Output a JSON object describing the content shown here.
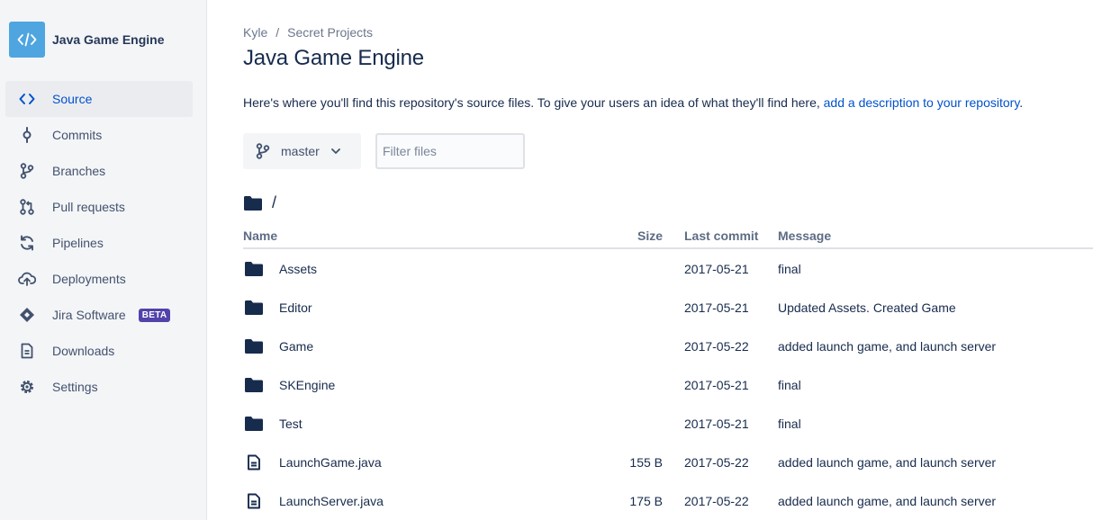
{
  "repo": {
    "name": "Java Game Engine"
  },
  "sidebar": {
    "items": [
      {
        "label": "Source",
        "icon": "code-icon",
        "active": true
      },
      {
        "label": "Commits",
        "icon": "commit-icon"
      },
      {
        "label": "Branches",
        "icon": "branch-icon"
      },
      {
        "label": "Pull requests",
        "icon": "pull-request-icon"
      },
      {
        "label": "Pipelines",
        "icon": "pipelines-icon"
      },
      {
        "label": "Deployments",
        "icon": "deployments-icon"
      },
      {
        "label": "Jira Software",
        "icon": "jira-icon",
        "badge": "BETA"
      },
      {
        "label": "Downloads",
        "icon": "downloads-icon"
      },
      {
        "label": "Settings",
        "icon": "gear-icon"
      }
    ]
  },
  "breadcrumb": {
    "owner": "Kyle",
    "separator": "/",
    "project": "Secret Projects"
  },
  "page": {
    "title": "Java Game Engine",
    "description_text": "Here's where you'll find this repository's source files. To give your users an idea of what they'll find here, ",
    "description_link": "add a description to your repository",
    "description_end": "."
  },
  "branch": {
    "name": "master"
  },
  "filter": {
    "placeholder": "Filter files",
    "value": ""
  },
  "path": {
    "current": "/"
  },
  "table": {
    "headers": {
      "name": "Name",
      "size": "Size",
      "last_commit": "Last commit",
      "message": "Message"
    },
    "rows": [
      {
        "type": "folder",
        "name": "Assets",
        "size": "",
        "date": "2017-05-21",
        "message": "final"
      },
      {
        "type": "folder",
        "name": "Editor",
        "size": "",
        "date": "2017-05-21",
        "message": "Updated Assets. Created Game"
      },
      {
        "type": "folder",
        "name": "Game",
        "size": "",
        "date": "2017-05-22",
        "message": "added launch game, and launch server"
      },
      {
        "type": "folder",
        "name": "SKEngine",
        "size": "",
        "date": "2017-05-21",
        "message": "final"
      },
      {
        "type": "folder",
        "name": "Test",
        "size": "",
        "date": "2017-05-21",
        "message": "final"
      },
      {
        "type": "file",
        "name": "LaunchGame.java",
        "size": "155 B",
        "date": "2017-05-22",
        "message": "added launch game, and launch server"
      },
      {
        "type": "file",
        "name": "LaunchServer.java",
        "size": "175 B",
        "date": "2017-05-22",
        "message": "added launch game, and launch server"
      }
    ]
  },
  "colors": {
    "accent": "#0052cc",
    "sidebar_bg": "#f4f5f7",
    "avatar": "#4ea5e0",
    "badge": "#5243aa",
    "text": "#172b4d"
  }
}
